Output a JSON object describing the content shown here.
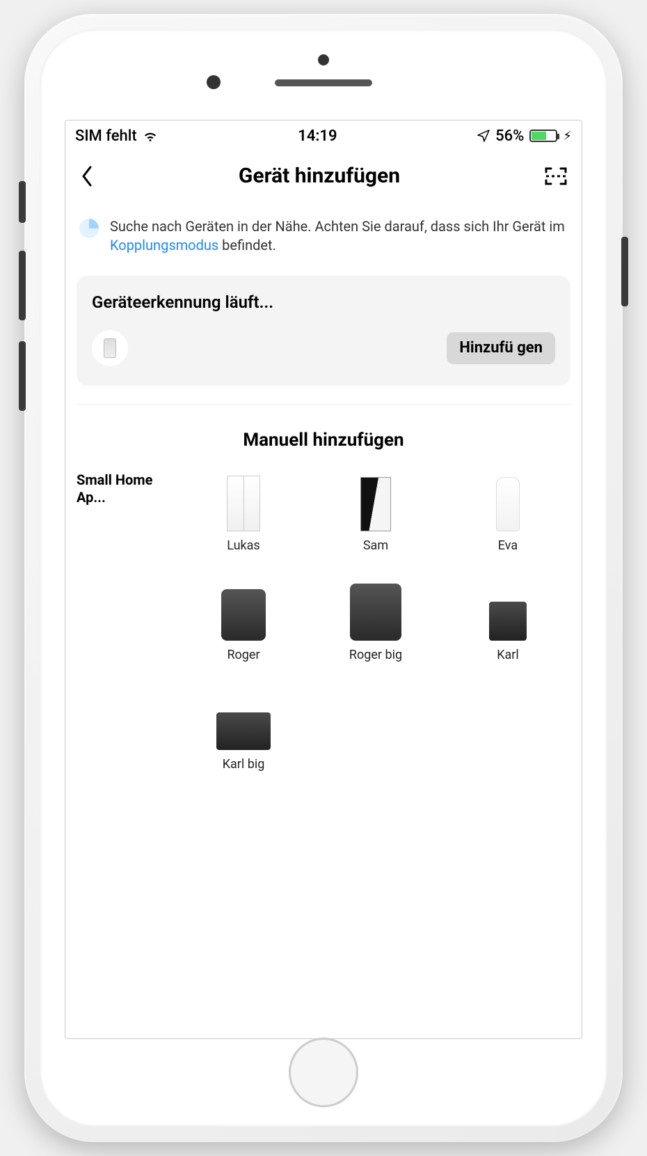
{
  "status": {
    "carrier": "SIM fehlt",
    "time": "14:19",
    "battery_pct": "56%"
  },
  "header": {
    "title": "Gerät hinzufügen"
  },
  "info": {
    "text_before_link": "Suche nach Geräten in der Nähe. Achten Sie darauf, dass sich Ihr Gerät im ",
    "link_text": "Kopplungsmodus",
    "text_after_link": " befindet."
  },
  "detection": {
    "title": "Geräteerkennung läuft...",
    "add_button": "Hinzufü gen"
  },
  "manual": {
    "title": "Manuell hinzufügen",
    "category": "Small Home Ap...",
    "devices": [
      {
        "name": "Lukas",
        "shape": "shape-lukas"
      },
      {
        "name": "Sam",
        "shape": "shape-sam"
      },
      {
        "name": "Eva",
        "shape": "shape-eva"
      },
      {
        "name": "Roger",
        "shape": "shape-roger"
      },
      {
        "name": "Roger big",
        "shape": "shape-rogerbig"
      },
      {
        "name": "Karl",
        "shape": "shape-karl"
      },
      {
        "name": "Karl big",
        "shape": "shape-karlbig"
      }
    ]
  }
}
